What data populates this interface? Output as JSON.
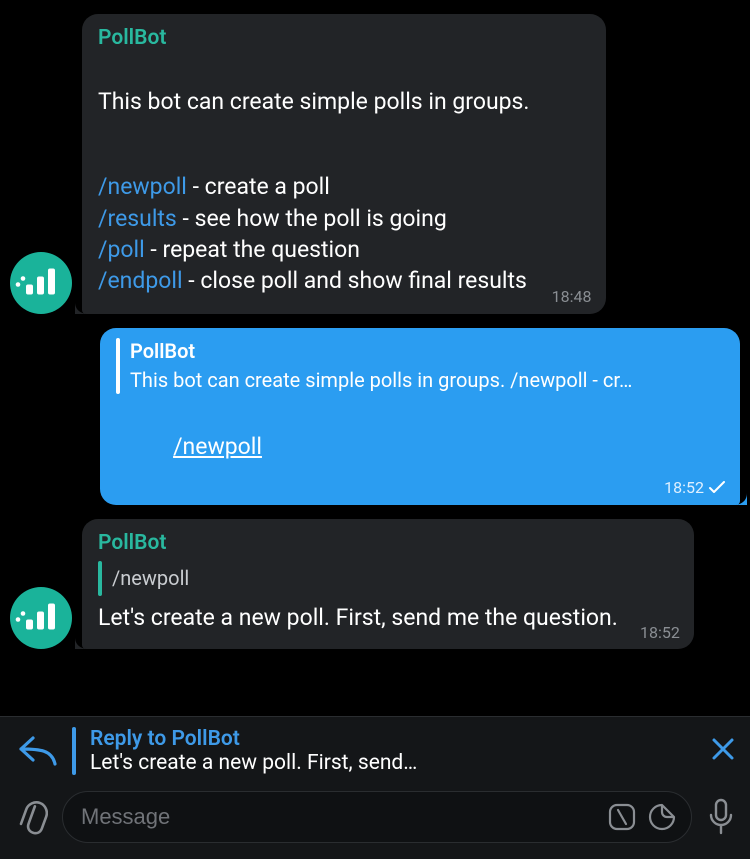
{
  "bot": {
    "name": "PollBot"
  },
  "colors": {
    "accent_blue": "#3e9ae8",
    "accent_teal": "#29b89f",
    "bubble_out": "#2b9df1"
  },
  "messages": {
    "intro": {
      "sender": "PollBot",
      "line_pre": "This bot can create simple polls in groups.",
      "cmd_newpoll": "/newpoll",
      "desc_newpoll": " - create a poll",
      "cmd_results": "/results",
      "desc_results": " - see how the poll is going",
      "cmd_poll": "/poll",
      "desc_poll": " - repeat the question",
      "cmd_endpoll": "/endpoll",
      "desc_endpoll": " - close poll and show final results",
      "time": "18:48"
    },
    "outgoing": {
      "reply_name": "PollBot",
      "reply_text": "This bot can create simple polls in groups. /newpoll - cr…",
      "body": "/newpoll",
      "time": "18:52"
    },
    "reply": {
      "sender": "PollBot",
      "reply_name": "",
      "reply_text": "/newpoll",
      "body": "Let's create a new poll. First, send me the question.",
      "time": "18:52"
    }
  },
  "composer": {
    "reply_title": "Reply to PollBot",
    "reply_preview": "Let's create a new poll. First, send…",
    "placeholder": "Message"
  }
}
